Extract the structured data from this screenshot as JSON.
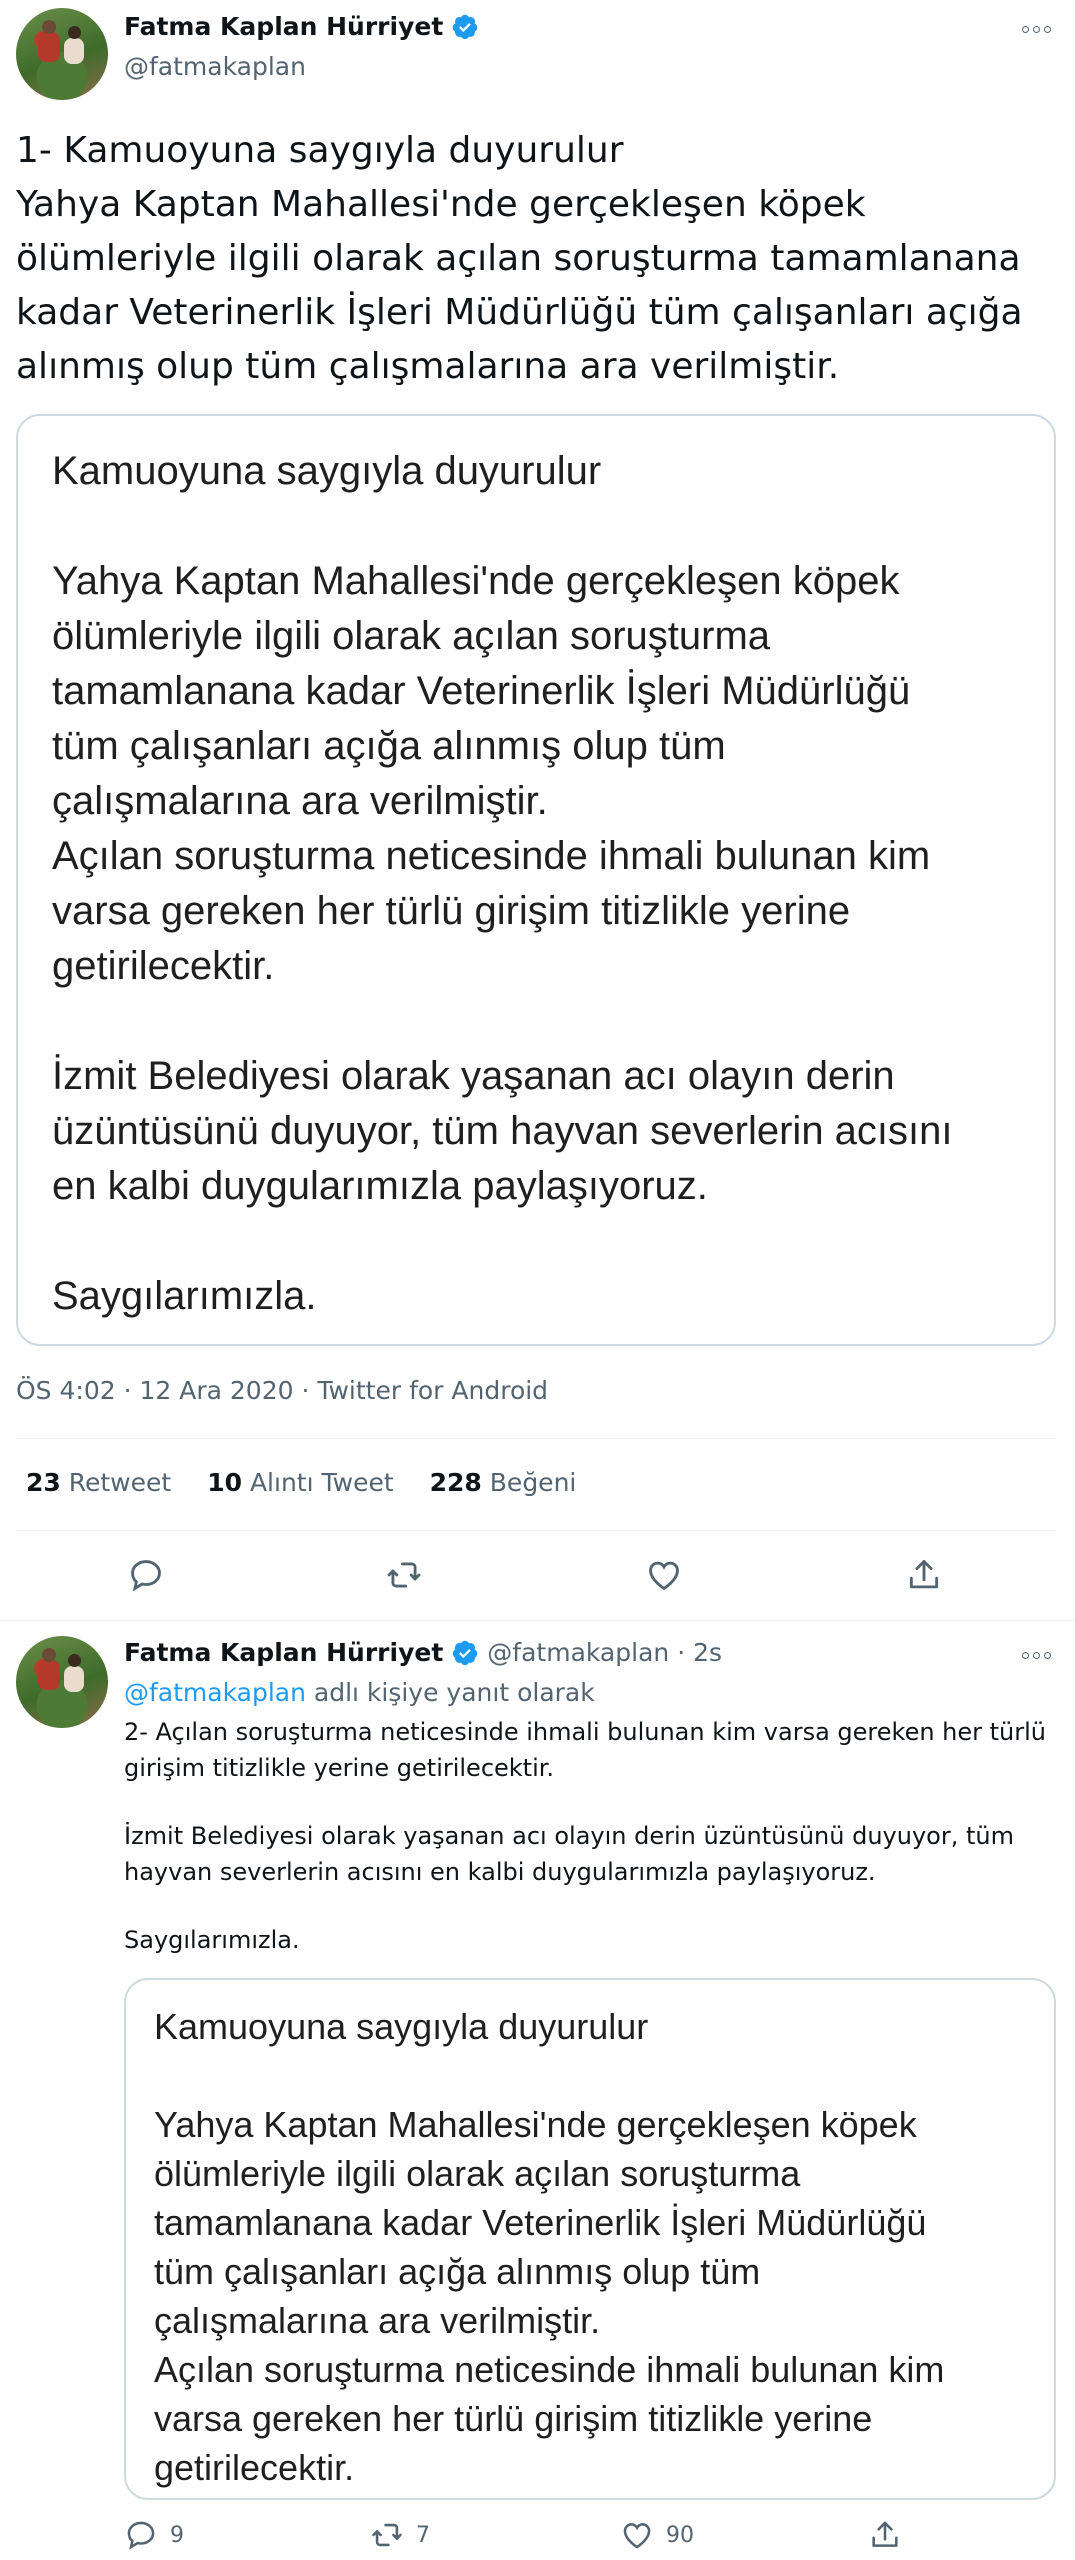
{
  "tweet1": {
    "author_name": "Fatma Kaplan Hürriyet",
    "author_handle": "@fatmakaplan",
    "text_lines": [
      "1- Kamuoyuna saygıyla duyurulur",
      "Yahya Kaptan Mahallesi'nde gerçekleşen köpek",
      "ölümleriyle ilgili olarak açılan soruşturma tamamlanana",
      "kadar Veterinerlik İşleri Müdürlüğü tüm çalışanları açığa",
      "alınmış olup tüm çalışmalarına ara verilmiştir."
    ],
    "image_lines": [
      "Kamuoyuna saygıyla duyurulur",
      "Yahya Kaptan Mahallesi'nde gerçekleşen köpek",
      "ölümleriyle ilgili olarak açılan soruşturma",
      "tamamlanana kadar Veterinerlik İşleri Müdürlüğü",
      "tüm çalışanları açığa alınmış olup tüm",
      "çalışmalarına ara verilmiştir.",
      "Açılan soruşturma neticesinde ihmali bulunan kim",
      "varsa gereken her türlü girişim titizlikle yerine",
      "getirilecektir.",
      "İzmit Belediyesi olarak yaşanan acı olayın derin",
      "üzüntüsünü duyuyor, tüm hayvan severlerin acısını",
      "en kalbi duygularımızla paylaşıyoruz.",
      "Saygılarımızla."
    ],
    "timestamp": "ÖS 4:02 · 12 Ara 2020 · Twitter for Android",
    "stats": {
      "retweets_count": "23",
      "retweets_label": "Retweet",
      "quotes_count": "10",
      "quotes_label": "Alıntı Tweet",
      "likes_count": "228",
      "likes_label": "Beğeni"
    }
  },
  "tweet2": {
    "author_name": "Fatma Kaplan Hürriyet",
    "author_handle": "@fatmakaplan",
    "time_ago": "· 2s",
    "replying_to_handle": "@fatmakaplan",
    "replying_to_suffix": " adlı kişiye yanıt olarak",
    "text_lines": [
      "2- Açılan soruşturma neticesinde ihmali bulunan kim varsa gereken her türlü",
      "girişim titizlikle yerine getirilecektir.",
      "İzmit Belediyesi olarak yaşanan acı olayın derin üzüntüsünü duyuyor, tüm",
      "hayvan severlerin acısını en kalbi duygularımızla paylaşıyoruz.",
      "Saygılarımızla."
    ],
    "image_lines": [
      "Kamuoyuna saygıyla duyurulur",
      "Yahya Kaptan Mahallesi'nde gerçekleşen köpek",
      "ölümleriyle ilgili olarak açılan soruşturma",
      "tamamlanana kadar Veterinerlik İşleri Müdürlüğü",
      "tüm çalışanları açığa alınmış olup tüm",
      "çalışmalarına ara verilmiştir.",
      "Açılan soruşturma neticesinde ihmali bulunan kim",
      "varsa gereken her türlü girişim titizlikle yerine",
      "getirilecektir."
    ],
    "actions": {
      "replies": "9",
      "retweets": "7",
      "likes": "90"
    }
  },
  "colors": {
    "text": "#0f1419",
    "secondary": "#536471",
    "link": "#1d9bf0",
    "verified": "#1d9bf0",
    "border": "#cfd9de"
  }
}
